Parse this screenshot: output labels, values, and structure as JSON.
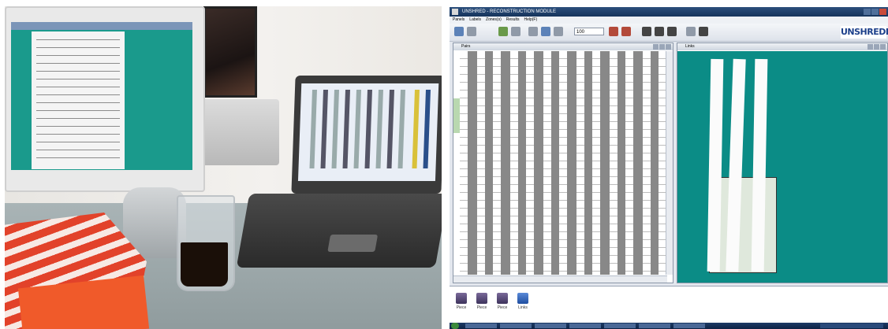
{
  "app": {
    "title": "UNSHRED - RECONSTRUCTION MODULE",
    "logo": "UNSHREDD",
    "menu": [
      "Panels",
      "Labels",
      "Zones(s)",
      "Results",
      "Help(F)"
    ],
    "zoom_value": "100",
    "left_pane_title": "Pairs",
    "right_pane_title": "Links",
    "bottom_items": [
      "Piece",
      "Piece",
      "Piece",
      "Links"
    ]
  },
  "colors": {
    "teal_canvas": "#0b8c86",
    "strip_green": "#b9d8b0",
    "title_bar": "#16345c"
  }
}
